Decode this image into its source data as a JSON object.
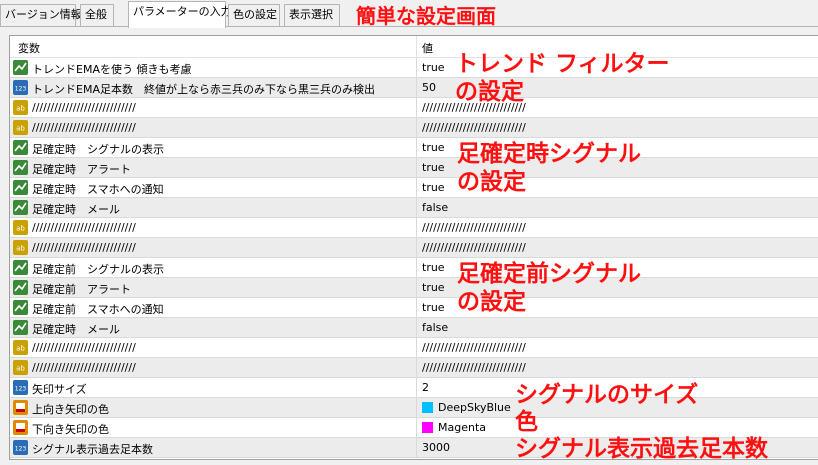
{
  "tabs": [
    {
      "label": "バージョン情報"
    },
    {
      "label": "全般"
    },
    {
      "label": "パラメーターの入力"
    },
    {
      "label": "色の設定"
    },
    {
      "label": "表示選択"
    }
  ],
  "table": {
    "headers": {
      "variable": "変数",
      "value": "値"
    },
    "rows": [
      {
        "icon": "bool",
        "name": "トレンドEMAを使う 傾きも考慮",
        "value": "true"
      },
      {
        "icon": "num",
        "name": "トレンドEMA足本数　終値が上なら赤三兵のみ下なら黒三兵のみ検出",
        "value": "50"
      },
      {
        "icon": "str",
        "name": "////////////////////////////",
        "value": "////////////////////////////"
      },
      {
        "icon": "str",
        "name": "////////////////////////////",
        "value": "////////////////////////////"
      },
      {
        "icon": "bool",
        "name": "足確定時　シグナルの表示",
        "value": "true"
      },
      {
        "icon": "bool",
        "name": "足確定時　アラート",
        "value": "true"
      },
      {
        "icon": "bool",
        "name": "足確定時　スマホへの通知",
        "value": "true"
      },
      {
        "icon": "bool",
        "name": "足確定時　メール",
        "value": "false"
      },
      {
        "icon": "str",
        "name": "////////////////////////////",
        "value": "////////////////////////////"
      },
      {
        "icon": "str",
        "name": "////////////////////////////",
        "value": "////////////////////////////"
      },
      {
        "icon": "bool",
        "name": "足確定前　シグナルの表示",
        "value": "true"
      },
      {
        "icon": "bool",
        "name": "足確定前　アラート",
        "value": "true"
      },
      {
        "icon": "bool",
        "name": "足確定前　スマホへの通知",
        "value": "true"
      },
      {
        "icon": "bool",
        "name": "足確定時　メール",
        "value": "false"
      },
      {
        "icon": "str",
        "name": "////////////////////////////",
        "value": "////////////////////////////"
      },
      {
        "icon": "str",
        "name": "////////////////////////////",
        "value": "////////////////////////////"
      },
      {
        "icon": "num",
        "name": "矢印サイズ",
        "value": "2"
      },
      {
        "icon": "col",
        "name": "上向き矢印の色",
        "value": "DeepSkyBlue",
        "color": "#00bfff"
      },
      {
        "icon": "col",
        "name": "下向き矢印の色",
        "value": "Magenta",
        "color": "#ff00ff"
      },
      {
        "icon": "num",
        "name": "シグナル表示過去足本数",
        "value": "3000"
      }
    ]
  },
  "annotations": {
    "title": "簡単な設定画面",
    "trend_1": "トレンド フィルター",
    "trend_2": "の設定",
    "confirmed_1": "足確定時シグナル",
    "confirmed_2": "の設定",
    "pre_1": "足確定前シグナル",
    "pre_2": "の設定",
    "size": "シグナルのサイズ",
    "color": "色",
    "bars": "シグナル表示過去足本数"
  },
  "colors": {
    "annotation": "#ff1010"
  }
}
